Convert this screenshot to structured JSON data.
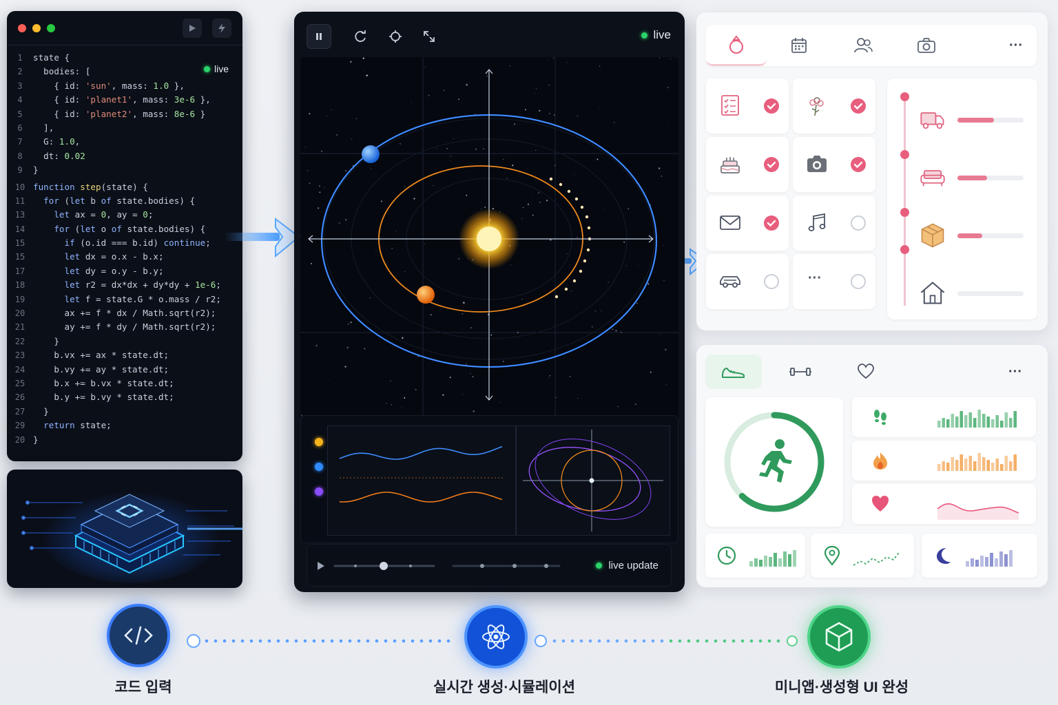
{
  "editor": {
    "live_label": "live",
    "lines": [
      {
        "n": "1",
        "code": "state {"
      },
      {
        "n": "2",
        "code": "  bodies: ["
      },
      {
        "n": "3",
        "code": "    { id: 'sun', mass: 1.0 },"
      },
      {
        "n": "4",
        "code": "    { id: 'planet1', mass: 3e-6 },"
      },
      {
        "n": "5",
        "code": "    { id: 'planet2', mass: 8e-6 }"
      },
      {
        "n": "6",
        "code": "  ],"
      },
      {
        "n": "7",
        "code": "  G: 1.0,"
      },
      {
        "n": "8",
        "code": "  dt: 0.02"
      },
      {
        "n": "9",
        "code": "}"
      },
      {
        "n": "10",
        "code": "function step(state) {"
      },
      {
        "n": "11",
        "code": "  for (let b of state.bodies) {"
      },
      {
        "n": "13",
        "code": "    let ax = 0, ay = 0;"
      },
      {
        "n": "14",
        "code": "    for (let o of state.bodies) {"
      },
      {
        "n": "15",
        "code": "      if (o.id === b.id) continue;"
      },
      {
        "n": "15",
        "code": "      let dx = o.x - b.x;"
      },
      {
        "n": "17",
        "code": "      let dy = o.y - b.y;"
      },
      {
        "n": "18",
        "code": "      let r2 = dx*dx + dy*dy + 1e-6;"
      },
      {
        "n": "19",
        "code": "      let f = state.G * o.mass / r2;"
      },
      {
        "n": "20",
        "code": "      ax += f * dx / Math.sqrt(r2);"
      },
      {
        "n": "21",
        "code": "      ay += f * dy / Math.sqrt(r2);"
      },
      {
        "n": "22",
        "code": "    }"
      },
      {
        "n": "23",
        "code": "    b.vx += ax * state.dt;"
      },
      {
        "n": "24",
        "code": "    b.vy += ay * state.dt;"
      },
      {
        "n": "25",
        "code": "    b.x += b.vx * state.dt;"
      },
      {
        "n": "26",
        "code": "    b.y += b.vy * state.dt;"
      },
      {
        "n": "27",
        "code": "  }"
      },
      {
        "n": "29",
        "code": "  return state;"
      },
      {
        "n": "20",
        "code": "}"
      }
    ]
  },
  "simulation": {
    "live_label": "live",
    "live_update_label": "live update",
    "toolbar_icons": [
      "pause-icon",
      "refresh-icon",
      "target-icon",
      "expand-icon"
    ],
    "legend_colors": [
      "#f5b31b",
      "#2f8bff",
      "#8a4dff"
    ]
  },
  "app_top": {
    "tabs": [
      "ring-icon",
      "calendar-icon",
      "users-icon",
      "camera-icon",
      "more-icon"
    ],
    "more_label": "···",
    "checklist": [
      {
        "icon": "checklist-icon",
        "checked": true
      },
      {
        "icon": "flower-icon",
        "checked": true
      },
      {
        "icon": "cake-icon",
        "checked": true
      },
      {
        "icon": "camera-icon",
        "checked": true
      },
      {
        "icon": "mail-icon",
        "checked": true
      },
      {
        "icon": "music-icon",
        "checked": false
      },
      {
        "icon": "car-icon",
        "checked": false
      },
      {
        "icon": "more-icon",
        "checked": false,
        "label": "···"
      }
    ],
    "progress": [
      {
        "icon": "truck-icon",
        "value": 0.55
      },
      {
        "icon": "sofa-icon",
        "value": 0.45
      },
      {
        "icon": "box-icon",
        "value": 0.37
      },
      {
        "icon": "home-icon",
        "value": 0.0
      }
    ]
  },
  "app_bot": {
    "tabs": [
      "sneaker-icon",
      "dumbbell-icon",
      "heart-icon",
      "more-icon"
    ],
    "more_label": "···",
    "ring_progress": 0.62,
    "stats": [
      {
        "icon": "footsteps-icon",
        "color": "#3faa67"
      },
      {
        "icon": "flame-icon",
        "color": "#f2a04a"
      },
      {
        "icon": "heart-rate-icon",
        "color": "#e8557a"
      }
    ],
    "mini": [
      {
        "icon": "clock-icon",
        "color": "#3faa67"
      },
      {
        "icon": "location-icon",
        "color": "#3faa67"
      },
      {
        "icon": "moon-icon",
        "color": "#3a3f9c"
      }
    ]
  },
  "flow": {
    "steps": [
      {
        "label": "코드 입력",
        "icon": "code-icon"
      },
      {
        "label": "실시간 생성·시뮬레이션",
        "icon": "atom-icon"
      },
      {
        "label": "미니앱·생성형 UI 완성",
        "icon": "cube-icon"
      }
    ]
  }
}
